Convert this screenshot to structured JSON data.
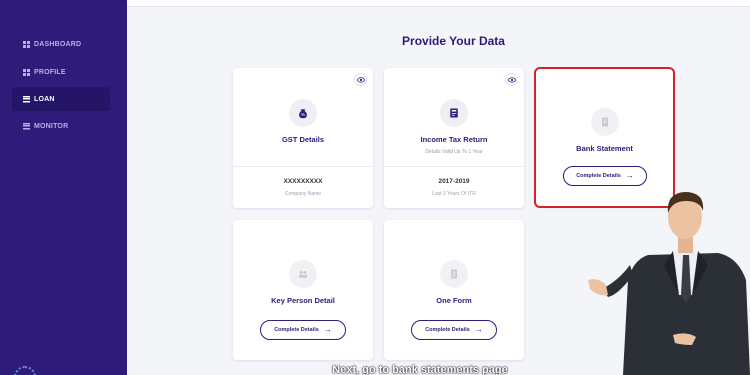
{
  "sidebar": {
    "items": [
      {
        "label": "DASHBOARD",
        "icon": "grid-icon"
      },
      {
        "label": "PROFILE",
        "icon": "grid-icon"
      },
      {
        "label": "LOAN",
        "icon": "list-icon",
        "active": true
      },
      {
        "label": "MONITOR",
        "icon": "list-icon"
      }
    ]
  },
  "main": {
    "title": "Provide Your Data",
    "cards": [
      {
        "title": "GST Details",
        "icon": "percent-bag-icon",
        "value": "XXXXXXXXX",
        "value_label": "Company Name"
      },
      {
        "title": "Income Tax Return",
        "subtitle": "Details Valid Up To 1 Year",
        "icon": "itr-document-icon",
        "value": "2017-2019",
        "value_label": "Last 3 Years Of ITR"
      },
      {
        "title": "Bank Statement",
        "icon": "bank-document-icon",
        "button": "Complete Details"
      },
      {
        "title": "Key Person Detail",
        "icon": "people-icon",
        "button": "Complete Details"
      },
      {
        "title": "One Form",
        "icon": "form-icon",
        "button": "Complete Details"
      }
    ]
  },
  "subtitle_caption": "Next, go to bank statements page",
  "colors": {
    "brand": "#2e1b7a",
    "highlight": "#d6202a"
  }
}
